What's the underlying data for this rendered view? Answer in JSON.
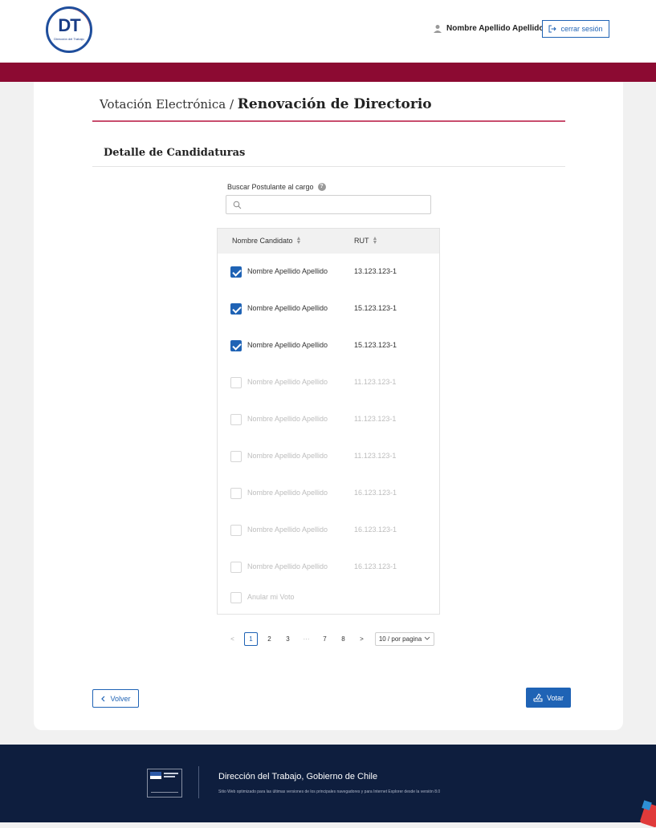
{
  "header": {
    "logo_text": "DT",
    "logo_subtitle": "Dirección del Trabajo",
    "user_name": "Nombre Apellido Apellido",
    "logout_label": "cerrar sesión"
  },
  "page": {
    "breadcrumb_prefix": "Votación Electrónica /",
    "title": "Renovación de Directorio",
    "section_title": "Detalle de Candidaturas"
  },
  "search": {
    "label": "Buscar Postulante al cargo",
    "help": "?",
    "value": "",
    "placeholder": ""
  },
  "table": {
    "columns": [
      "Nombre Candidato",
      "RUT"
    ],
    "rows": [
      {
        "name": "Nombre Apellido Apellido",
        "rut": "13.123.123-1",
        "checked": true,
        "disabled": false
      },
      {
        "name": "Nombre Apellido Apellido",
        "rut": "15.123.123-1",
        "checked": true,
        "disabled": false
      },
      {
        "name": "Nombre Apellido Apellido",
        "rut": "15.123.123-1",
        "checked": true,
        "disabled": false
      },
      {
        "name": "Nombre Apellido Apellido",
        "rut": "11.123.123-1",
        "checked": false,
        "disabled": true
      },
      {
        "name": "Nombre Apellido Apellido",
        "rut": "11.123.123-1",
        "checked": false,
        "disabled": true
      },
      {
        "name": "Nombre Apellido Apellido",
        "rut": "11.123.123-1",
        "checked": false,
        "disabled": true
      },
      {
        "name": "Nombre Apellido Apellido",
        "rut": "16.123.123-1",
        "checked": false,
        "disabled": true
      },
      {
        "name": "Nombre Apellido Apellido",
        "rut": "16.123.123-1",
        "checked": false,
        "disabled": true
      },
      {
        "name": "Nombre Apellido Apellido",
        "rut": "16.123.123-1",
        "checked": false,
        "disabled": true
      }
    ],
    "annul_label": "Anular mi Voto"
  },
  "pagination": {
    "prev": "<",
    "pages": [
      "1",
      "2",
      "3",
      "···",
      "7",
      "8"
    ],
    "current": "1",
    "next": ">",
    "per_page": "10 / por pagina"
  },
  "actions": {
    "back_label": "Volver",
    "vote_label": "Votar"
  },
  "footer": {
    "title": "Dirección del Trabajo, Gobierno de Chile",
    "note": "Sitio Web optimizado para las últimas versiones de los principales navegadores y para Internet Explorer desde la versión 8.0"
  },
  "colors": {
    "brand_red": "#8c0a32",
    "primary_blue": "#1f63b5",
    "footer_navy": "#0e1e3e"
  }
}
